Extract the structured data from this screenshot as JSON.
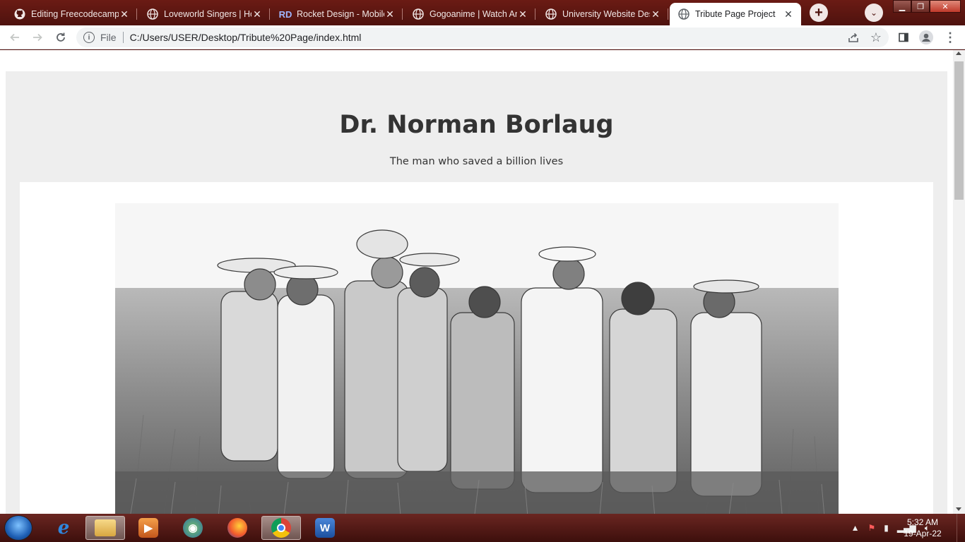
{
  "browser": {
    "tabs": [
      {
        "title": "Editing Freecodecamp/",
        "icon": "github-icon"
      },
      {
        "title": "Loveworld Singers | Ho",
        "icon": "globe-icon"
      },
      {
        "title": "Rocket Design - Mobile",
        "icon": "rocket-design-icon"
      },
      {
        "title": "Gogoanime | Watch An",
        "icon": "globe-icon"
      },
      {
        "title": "University Website Des",
        "icon": "globe-icon"
      },
      {
        "title": "Tribute Page Project",
        "icon": "globe-icon",
        "active": true
      }
    ],
    "omnibox": {
      "scheme": "File",
      "url": "C:/Users/USER/Desktop/Tribute%20Page/index.html"
    }
  },
  "page": {
    "title": "Dr. Norman Borlaug",
    "subtitle": "The man who saved a billion lives"
  },
  "taskbar": {
    "apps": [
      "internet-explorer",
      "file-explorer",
      "media-player",
      "media-center",
      "firefox",
      "chrome",
      "word"
    ],
    "active_app": "chrome",
    "clock": {
      "time": "5:32 AM",
      "date": "19-Apr-22"
    }
  }
}
